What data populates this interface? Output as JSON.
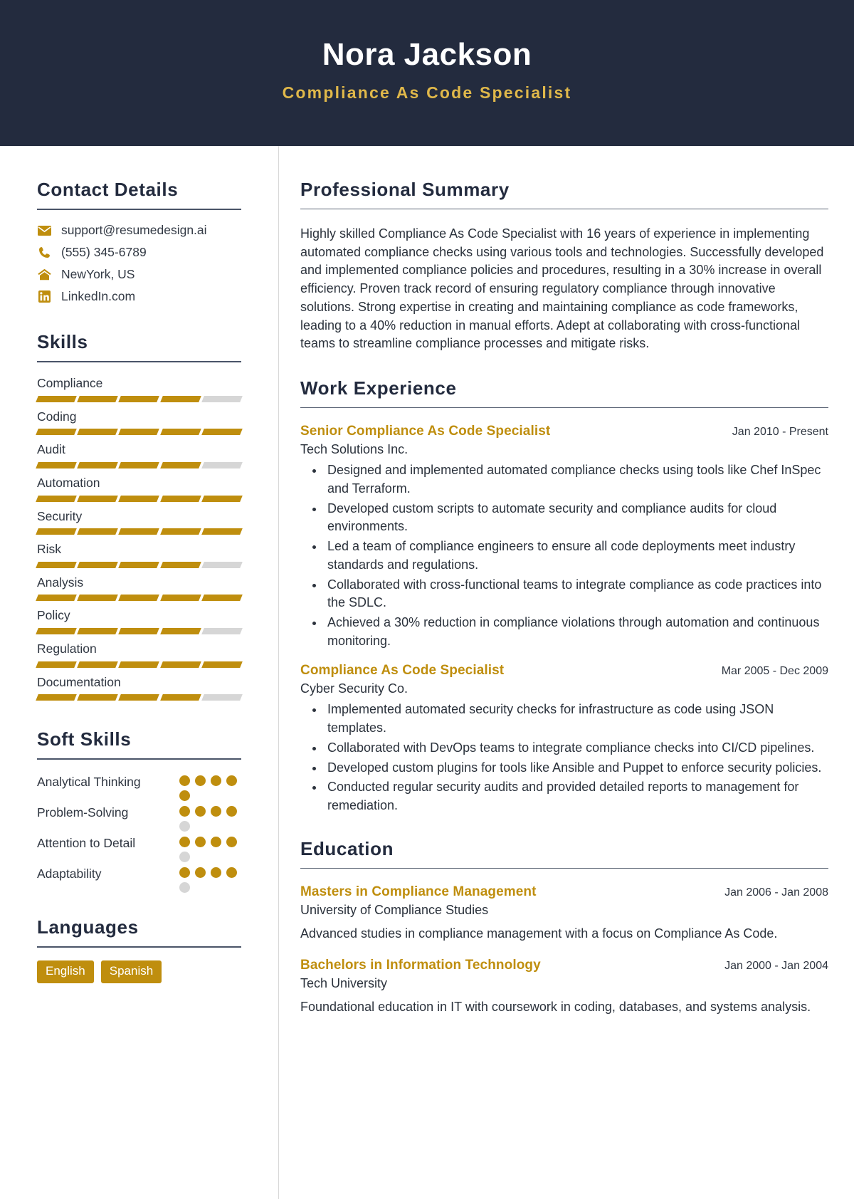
{
  "header": {
    "name": "Nora Jackson",
    "job_title": "Compliance As Code Specialist",
    "bg_color": "#232b3e",
    "accent_color": "#e0b84a"
  },
  "theme": {
    "gold": "#bf8e0e",
    "navy": "#232b3e",
    "muted": "#d6d6d6"
  },
  "sidebar": {
    "contact": {
      "title": "Contact Details",
      "items": [
        {
          "icon": "envelope-icon",
          "value": "support@resumedesign.ai"
        },
        {
          "icon": "phone-icon",
          "value": "(555) 345-6789"
        },
        {
          "icon": "home-icon",
          "value": "NewYork, US"
        },
        {
          "icon": "linkedin-icon",
          "value": "LinkedIn.com"
        }
      ]
    },
    "skills": {
      "title": "Skills",
      "max": 5,
      "items": [
        {
          "name": "Compliance",
          "level": 4
        },
        {
          "name": "Coding",
          "level": 5
        },
        {
          "name": "Audit",
          "level": 4
        },
        {
          "name": "Automation",
          "level": 5
        },
        {
          "name": "Security",
          "level": 5
        },
        {
          "name": "Risk",
          "level": 4
        },
        {
          "name": "Analysis",
          "level": 5
        },
        {
          "name": "Policy",
          "level": 4
        },
        {
          "name": "Regulation",
          "level": 5
        },
        {
          "name": "Documentation",
          "level": 4
        }
      ]
    },
    "soft_skills": {
      "title": "Soft Skills",
      "max": 5,
      "items": [
        {
          "name": "Analytical Thinking",
          "level": 5
        },
        {
          "name": "Problem-Solving",
          "level": 4
        },
        {
          "name": "Attention to Detail",
          "level": 4
        },
        {
          "name": "Adaptability",
          "level": 4
        }
      ]
    },
    "languages": {
      "title": "Languages",
      "items": [
        "English",
        "Spanish"
      ]
    }
  },
  "main": {
    "summary": {
      "title": "Professional Summary",
      "text": "Highly skilled Compliance As Code Specialist with 16 years of experience in implementing automated compliance checks using various tools and technologies. Successfully developed and implemented compliance policies and procedures, resulting in a 30% increase in overall efficiency. Proven track record of ensuring regulatory compliance through innovative solutions. Strong expertise in creating and maintaining compliance as code frameworks, leading to a 40% reduction in manual efforts. Adept at collaborating with cross-functional teams to streamline compliance processes and mitigate risks."
    },
    "work": {
      "title": "Work Experience",
      "entries": [
        {
          "title": "Senior Compliance As Code Specialist",
          "date": "Jan 2010 - Present",
          "org": "Tech Solutions Inc.",
          "bullets": [
            "Designed and implemented automated compliance checks using tools like Chef InSpec and Terraform.",
            "Developed custom scripts to automate security and compliance audits for cloud environments.",
            "Led a team of compliance engineers to ensure all code deployments meet industry standards and regulations.",
            "Collaborated with cross-functional teams to integrate compliance as code practices into the SDLC.",
            "Achieved a 30% reduction in compliance violations through automation and continuous monitoring."
          ]
        },
        {
          "title": "Compliance As Code Specialist",
          "date": "Mar 2005 - Dec 2009",
          "org": "Cyber Security Co.",
          "bullets": [
            "Implemented automated security checks for infrastructure as code using JSON templates.",
            "Collaborated with DevOps teams to integrate compliance checks into CI/CD pipelines.",
            "Developed custom plugins for tools like Ansible and Puppet to enforce security policies.",
            "Conducted regular security audits and provided detailed reports to management for remediation."
          ]
        }
      ]
    },
    "education": {
      "title": "Education",
      "entries": [
        {
          "title": "Masters in Compliance Management",
          "date": "Jan 2006 - Jan 2008",
          "org": "University of Compliance Studies",
          "description": "Advanced studies in compliance management with a focus on Compliance As Code."
        },
        {
          "title": "Bachelors in Information Technology",
          "date": "Jan 2000 - Jan 2004",
          "org": "Tech University",
          "description": "Foundational education in IT with coursework in coding, databases, and systems analysis."
        }
      ]
    }
  }
}
